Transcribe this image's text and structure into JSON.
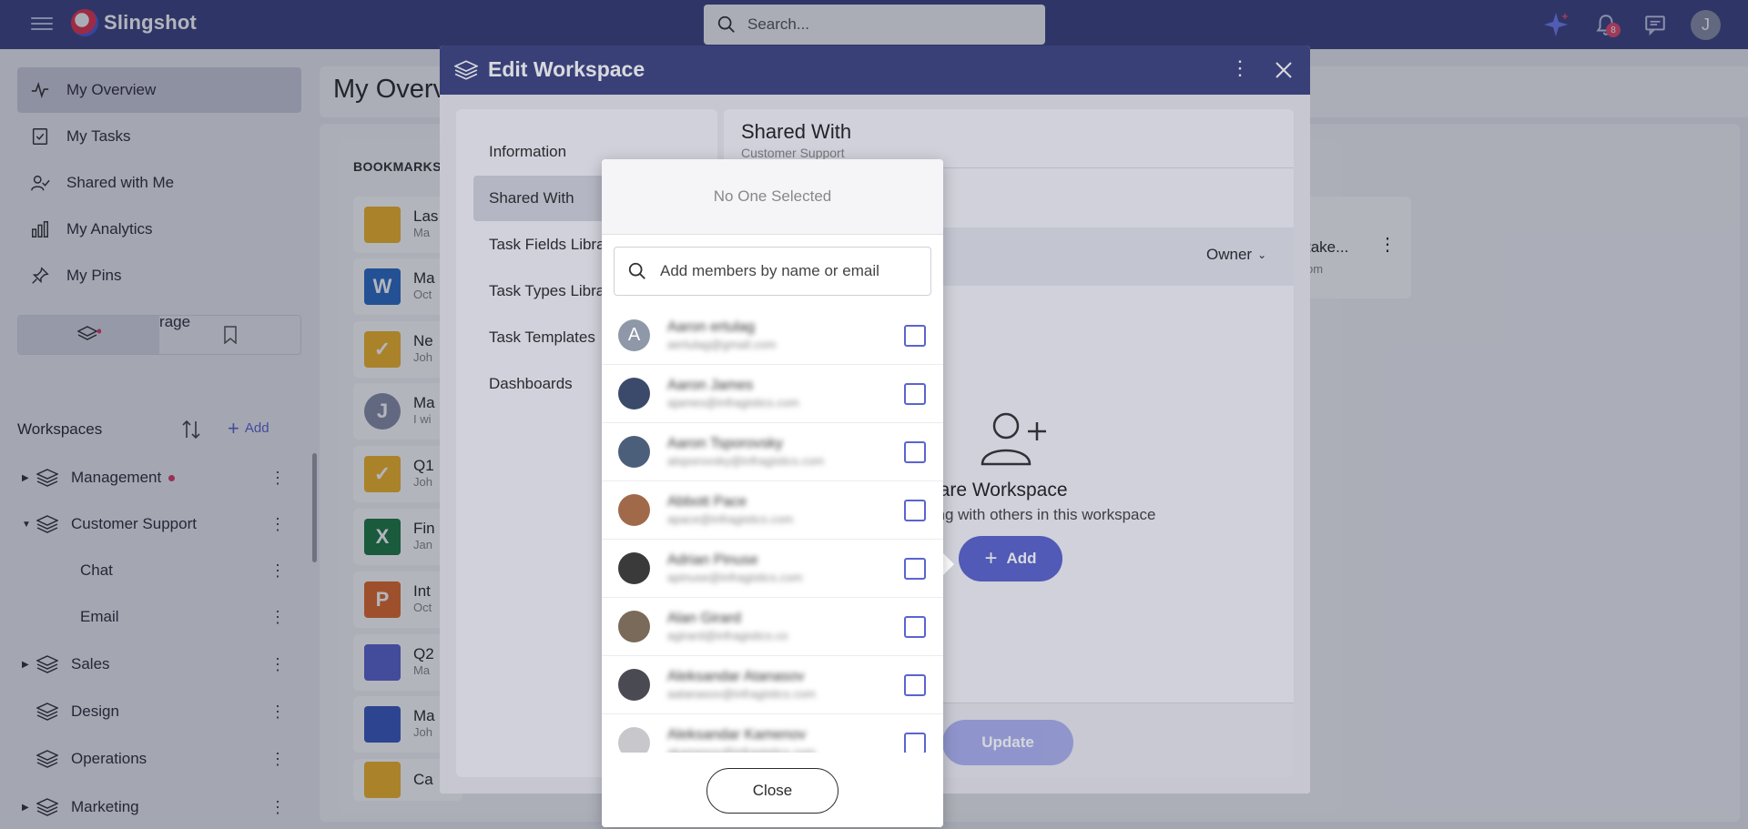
{
  "app": {
    "name": "Slingshot"
  },
  "topbar": {
    "search_placeholder": "Search...",
    "notification_count": "8",
    "user_initial": "J"
  },
  "sidebar": {
    "nav": [
      {
        "label": "My Overview",
        "icon": "pulse-icon",
        "active": true
      },
      {
        "label": "My Tasks",
        "icon": "task-check-icon"
      },
      {
        "label": "Shared with Me",
        "icon": "shared-user-icon"
      },
      {
        "label": "My Analytics",
        "icon": "bar-chart-icon"
      },
      {
        "label": "My Pins",
        "icon": "pin-icon"
      },
      {
        "label": "My Cloud Storage",
        "icon": "cloud-icon"
      }
    ],
    "workspaces_label": "Workspaces",
    "add_label": "Add",
    "tree": [
      {
        "label": "Management",
        "has_dot": true
      },
      {
        "label": "Customer Support"
      },
      {
        "label": "Chat"
      },
      {
        "label": "Email"
      },
      {
        "label": "Sales"
      },
      {
        "label": "Design"
      },
      {
        "label": "Operations"
      },
      {
        "label": "Marketing"
      }
    ]
  },
  "main": {
    "title": "My Overview",
    "bookmarks_label": "BOOKMARKS",
    "bookmarks": [
      {
        "title": "Las",
        "sub": "Ma",
        "color": "#f0b429"
      },
      {
        "title": "Ma",
        "sub": "Oct",
        "color": "#2b6cc4",
        "glyph": "W"
      },
      {
        "title": "Ne",
        "sub": "Joh",
        "color": "#f0b429"
      },
      {
        "title": "Ma",
        "sub": "I wi",
        "color": "#8a8ea8",
        "glyph": "J"
      },
      {
        "title": "Q1",
        "sub": "Joh",
        "color": "#f0b429"
      },
      {
        "title": "Fin",
        "sub": "Jan",
        "color": "#1e7a45",
        "glyph": "X"
      },
      {
        "title": "Int",
        "sub": "Oct",
        "color": "#e06a2c",
        "glyph": "P"
      },
      {
        "title": "Q2",
        "sub": "Ma",
        "color": "#5b64cf"
      },
      {
        "title": "Ma",
        "sub": "Joh",
        "color": "#3a5bbf"
      },
      {
        "title": "Ca",
        "sub": "",
        "color": "#f0b429"
      }
    ],
    "right_card": {
      "line1": ":",
      "line2": "take...",
      "line3": "om"
    }
  },
  "dialog": {
    "title": "Edit Workspace",
    "menu": [
      {
        "label": "Information"
      },
      {
        "label": "Shared With",
        "active": true
      },
      {
        "label": "Task Fields Libra"
      },
      {
        "label": "Task Types Libra"
      },
      {
        "label": "Task Templates"
      },
      {
        "label": "Dashboards"
      }
    ],
    "pane": {
      "title": "Shared With",
      "subtitle": "Customer Support",
      "owner_label": "Owner",
      "share_title": "hare Workspace",
      "share_desc": "ting with others in this workspace",
      "add_label": "Add",
      "update_label": "Update"
    }
  },
  "picker": {
    "header": "No One Selected",
    "search_placeholder": "Add members by name or email",
    "close_label": "Close",
    "members": [
      {
        "name": "Aaron ertulag",
        "email": "aertulag@gmail.com",
        "avatar": "A",
        "color": "#8f98a8"
      },
      {
        "name": "Aaron James",
        "email": "ajames@infragistics.com",
        "color": "#3b4a6b"
      },
      {
        "name": "Aaron Tsporovsky",
        "email": "atsporovsky@infragistics.com",
        "color": "#4c5f7a"
      },
      {
        "name": "Abbott Pace",
        "email": "apace@infragistics.com",
        "color": "#a06a4a"
      },
      {
        "name": "Adrian Pinuse",
        "email": "apinuse@infragistics.com",
        "color": "#3a3a3a"
      },
      {
        "name": "Alan Girard",
        "email": "agirard@infragistics.co",
        "color": "#7a6a5a"
      },
      {
        "name": "Aleksandar Atanasov",
        "email": "aatanasov@infragistics.com",
        "color": "#4a4a52"
      },
      {
        "name": "Aleksandar Kamenov",
        "email": "akamenov@infragistics.com",
        "color": "#c8c8cc"
      }
    ]
  }
}
